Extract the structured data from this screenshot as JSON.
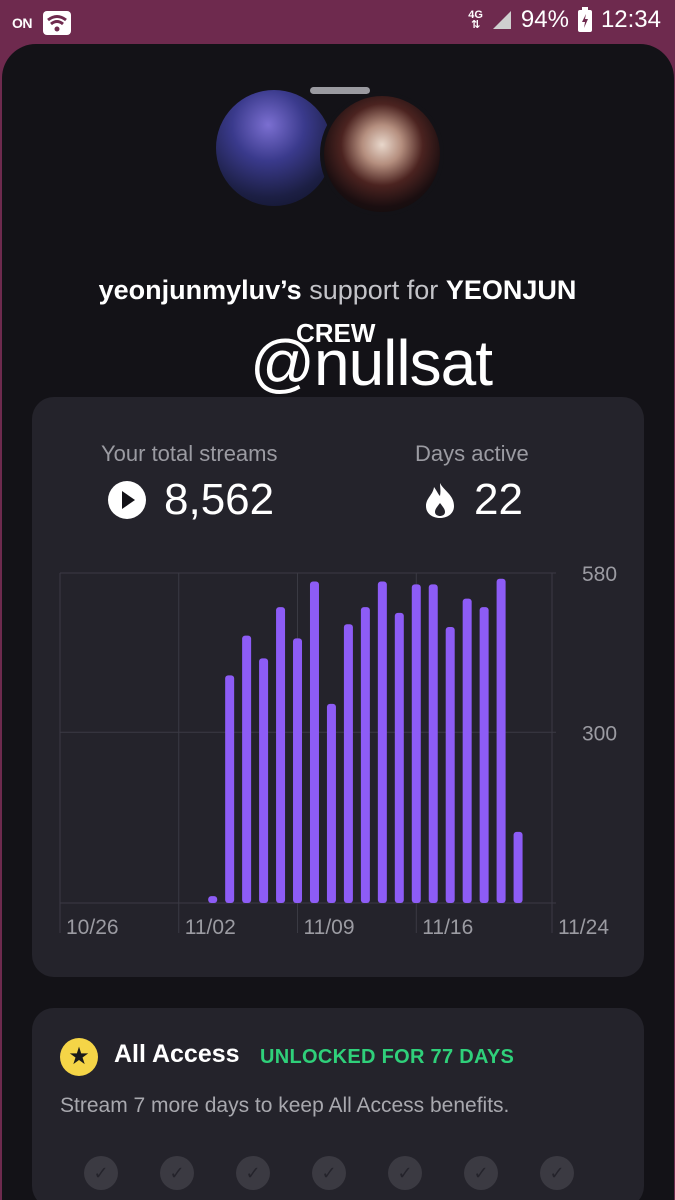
{
  "status_bar": {
    "battery": "94%",
    "time": "12:34",
    "network": "4G",
    "carrier_icon": "on-icon",
    "wifi_icon": "wifi-icon"
  },
  "header": {
    "username": "yeonjunmyluv’s",
    "support_text": "support for",
    "artist": "YEONJUN",
    "crew": "CREW",
    "watermark": "@nullsat"
  },
  "stats": {
    "total_streams_label": "Your total streams",
    "total_streams": "8,562",
    "days_active_label": "Days active",
    "days_active": "22"
  },
  "chart_data": {
    "type": "bar",
    "x_tick_labels": [
      "10/26",
      "11/02",
      "11/09",
      "11/16",
      "11/24"
    ],
    "y_tick_labels": [
      "580",
      "300"
    ],
    "ylim": [
      0,
      580
    ],
    "grid": true,
    "bar_color": "#8d5cf6",
    "dates": [
      "11/04",
      "11/05",
      "11/06",
      "11/07",
      "11/08",
      "11/09",
      "11/10",
      "11/11",
      "11/12",
      "11/13",
      "11/14",
      "11/15",
      "11/16",
      "11/17",
      "11/18",
      "11/19",
      "11/20",
      "11/21",
      "11/22",
      "11/23"
    ],
    "values": [
      12,
      400,
      470,
      430,
      520,
      465,
      565,
      350,
      490,
      520,
      565,
      510,
      560,
      560,
      485,
      535,
      520,
      570,
      125,
      0
    ],
    "x_start": "10/26",
    "x_end": "11/24"
  },
  "all_access": {
    "title": "All Access",
    "badge": "UNLOCKED FOR 77 DAYS",
    "description": "Stream 7 more days to keep All Access benefits.",
    "checks": [
      "✓",
      "✓",
      "✓",
      "✓",
      "✓",
      "✓",
      "✓"
    ],
    "badge_color": "#2fd07a",
    "star_color": "#f5d547"
  }
}
